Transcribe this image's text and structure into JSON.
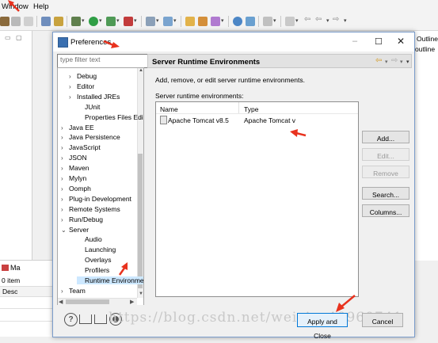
{
  "menubar": {
    "items": [
      "Window",
      "Help"
    ]
  },
  "left_panel": {
    "bottom_title": "Ma",
    "bottom_count": "0 item",
    "bottom_col": "Desc"
  },
  "right_panel": {
    "lines": [
      "Outline",
      "outline"
    ]
  },
  "dialog": {
    "title": "Preferences",
    "filter_placeholder": "type filter text",
    "tree": [
      {
        "label": "Debug",
        "arrow": "›"
      },
      {
        "label": "Editor",
        "arrow": "›"
      },
      {
        "label": "Installed JREs",
        "arrow": "›"
      },
      {
        "label": "JUnit",
        "arrow": ""
      },
      {
        "label": "Properties Files Edi",
        "arrow": ""
      },
      {
        "label": "Java EE",
        "arrow": "›"
      },
      {
        "label": "Java Persistence",
        "arrow": "›"
      },
      {
        "label": "JavaScript",
        "arrow": "›"
      },
      {
        "label": "JSON",
        "arrow": "›"
      },
      {
        "label": "Maven",
        "arrow": "›"
      },
      {
        "label": "Mylyn",
        "arrow": "›"
      },
      {
        "label": "Oomph",
        "arrow": "›"
      },
      {
        "label": "Plug-in Development",
        "arrow": "›"
      },
      {
        "label": "Remote Systems",
        "arrow": "›"
      },
      {
        "label": "Run/Debug",
        "arrow": "›"
      },
      {
        "label": "Server",
        "arrow": "⌄"
      },
      {
        "label": "Audio",
        "arrow": ""
      },
      {
        "label": "Launching",
        "arrow": ""
      },
      {
        "label": "Overlays",
        "arrow": ""
      },
      {
        "label": "Profilers",
        "arrow": ""
      },
      {
        "label": "Runtime Environme",
        "arrow": ""
      },
      {
        "label": "Team",
        "arrow": "›"
      }
    ],
    "page_title": "Server Runtime Environments",
    "description": "Add, remove, or edit server runtime environments.",
    "list_label": "Server runtime environments:",
    "table": {
      "headers": [
        "Name",
        "Type"
      ],
      "rows": [
        [
          "Apache Tomcat v8.5",
          "Apache Tomcat v"
        ]
      ]
    },
    "buttons": {
      "add": "Add...",
      "edit": "Edit...",
      "remove": "Remove",
      "search": "Search...",
      "columns": "Columns..."
    },
    "footer": {
      "apply_close": "Apply and Close",
      "cancel": "Cancel"
    },
    "watermark": "https://blog.csdn.net/weixin_40960741"
  },
  "colors": {
    "accent": "#0078d7",
    "selection": "#cde8ff",
    "annotation": "#e8321e"
  }
}
